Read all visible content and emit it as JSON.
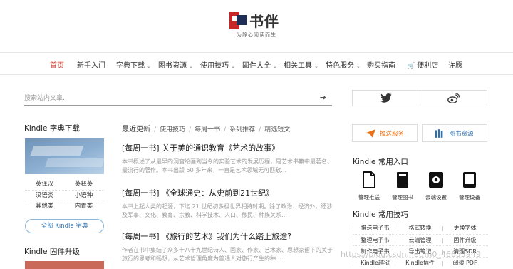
{
  "brand": {
    "name": "书伴",
    "slogan": "为静心阅读而生"
  },
  "nav": [
    {
      "label": "首页",
      "active": true,
      "dropdown": false
    },
    {
      "label": "新手入门",
      "dropdown": false
    },
    {
      "label": "字典下载",
      "dropdown": true
    },
    {
      "label": "图书资源",
      "dropdown": true
    },
    {
      "label": "使用技巧",
      "dropdown": true
    },
    {
      "label": "固件大全",
      "dropdown": true
    },
    {
      "label": "相关工具",
      "dropdown": true
    },
    {
      "label": "特色服务",
      "dropdown": true
    },
    {
      "label": "购买指南",
      "dropdown": false
    },
    {
      "label": "便利店",
      "dropdown": false,
      "icon": "cart-icon"
    },
    {
      "label": "许愿",
      "dropdown": false
    }
  ],
  "search": {
    "placeholder": "搜索站内文章…",
    "icon": "arrow-right-icon"
  },
  "left": {
    "dict_title": "Kindle 字典下载",
    "dict_links": [
      [
        "英译汉",
        "英释英"
      ],
      [
        "汉语类",
        "小语种"
      ],
      [
        "其他类",
        "内置类"
      ]
    ],
    "dict_all": "全部 Kindle 字典",
    "firmware_title": "Kindle 固件升级"
  },
  "main": {
    "tabs": [
      "最近更新",
      "使用技巧",
      "每周一书",
      "系列推荐",
      "精选短文"
    ],
    "posts": [
      {
        "title": "[每周一书] 关于美的通识教育《艺术的故事》",
        "excerpt": "本书概述了从最早的洞窟绘画到当今的实验艺术的发展历程，是艺术书籍中最著名、最流行的著作。本书出版 50 多年来，一直是艺术领域无可匹敌…"
      },
      {
        "title": "[每周一书] 《全球通史：从史前到21世纪》",
        "excerpt": "本书上起人类的起源，下迄 21 世纪初多极世界相持时期。除了政治、经济外，还涉及军事、文化、教育、宗教、科学技术、人口、移民、种族关系…"
      },
      {
        "title": "[每周一书] 《旅行的艺术》我们为什么踏上旅途?",
        "excerpt": "作者在书中集结了众多十八十九世纪诗人、画家、作家、艺术家、思想家留下的关于旅行的思考和畅想，从艺术哲理角度为普通人对旅行产生的种…"
      }
    ]
  },
  "right": {
    "social": [
      {
        "icon": "twitter-icon"
      },
      {
        "icon": "weibo-icon"
      }
    ],
    "services": [
      {
        "label": "推送服务",
        "icon": "paper-plane-icon",
        "color": "#e8731a"
      },
      {
        "label": "图书资源",
        "icon": "books-icon",
        "color": "#2f6ea8"
      }
    ],
    "entry_title": "Kindle 常用入口",
    "entries": [
      {
        "label": "管理推送",
        "icon": "document-icon"
      },
      {
        "label": "管理图书",
        "icon": "book-icon"
      },
      {
        "label": "云端设置",
        "icon": "settings-icon"
      },
      {
        "label": "管理设备",
        "icon": "tablet-icon"
      }
    ],
    "tools_title": "Kindle 常用技巧",
    "tools": [
      [
        "推送电子书",
        "格式转换",
        "更换字体"
      ],
      [
        "整理电子书",
        "云端管理",
        "固件升级"
      ],
      [
        "制作电子书",
        "导出笔记",
        "清理SDR"
      ],
      [
        "Kindle越狱",
        "Kindle插件",
        "阅读 PDF"
      ]
    ]
  },
  "watermark": "https://blog.csdn.net/m0_46653949"
}
